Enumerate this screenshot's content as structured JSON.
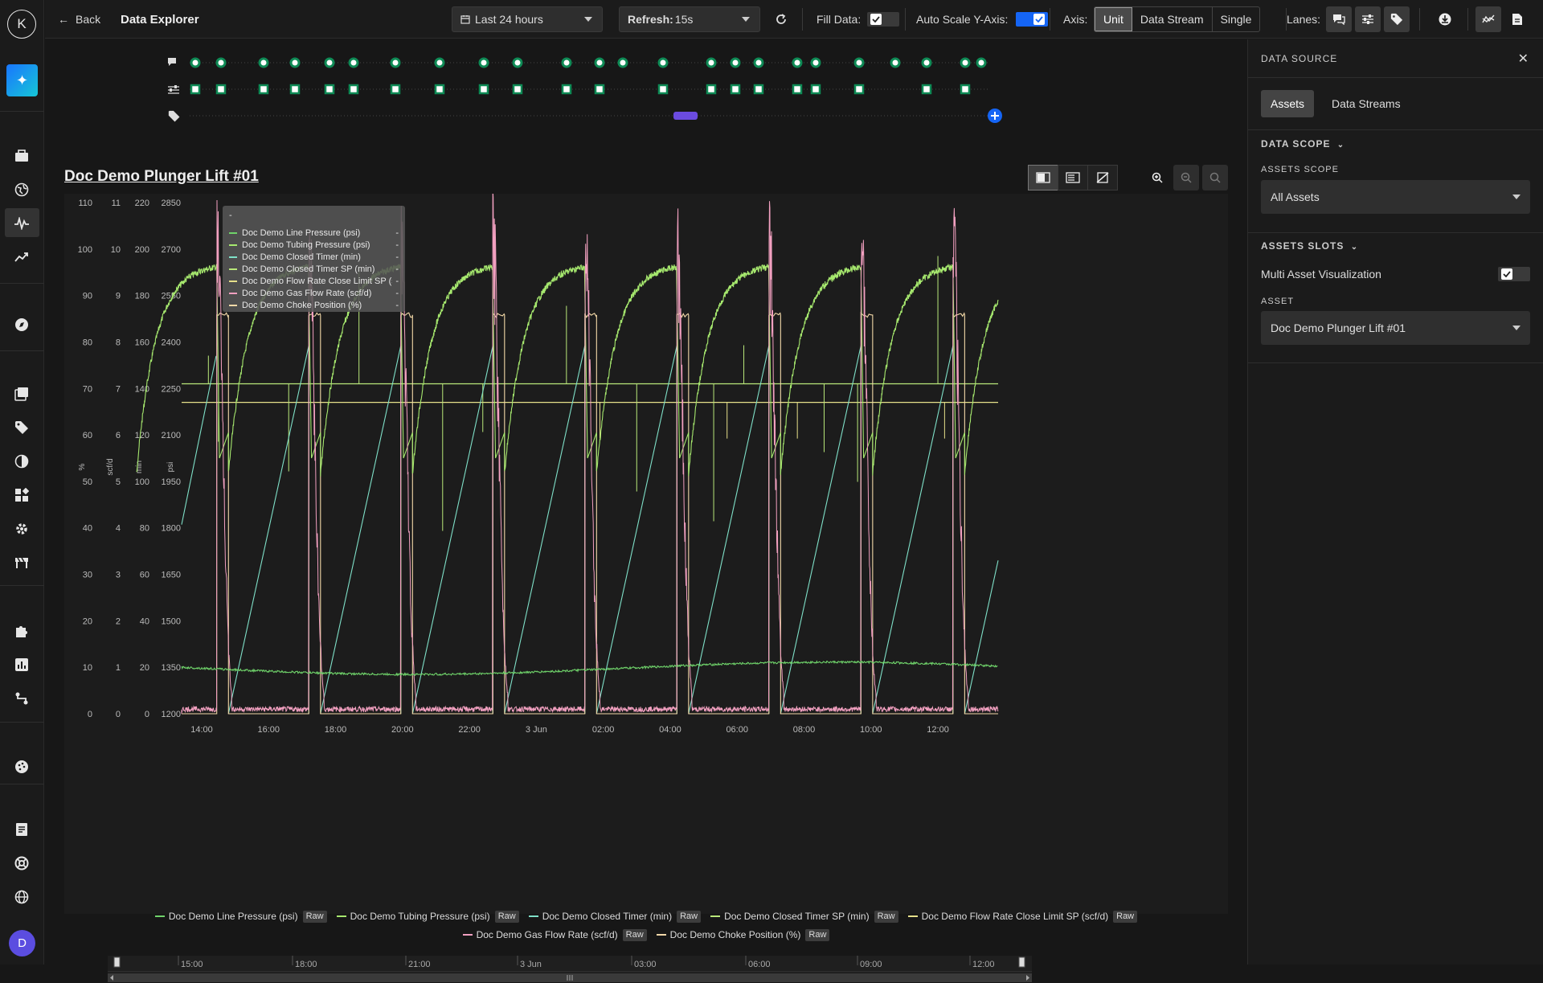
{
  "header": {
    "back_label": "Back",
    "title": "Data Explorer",
    "time_range": "Last 24 hours",
    "refresh_label": "Refresh:",
    "refresh_value": "15s",
    "fill_data_label": "Fill Data:",
    "fill_data_checked": true,
    "auto_scale_label": "Auto Scale Y-Axis:",
    "auto_scale_on": true,
    "axis_label": "Axis:",
    "axis_options": [
      "Unit",
      "Data Stream",
      "Single"
    ],
    "axis_selected": "Unit",
    "lanes_label": "Lanes:"
  },
  "sidebar": {
    "logo_letter": "K",
    "avatar_letter": "D"
  },
  "chart": {
    "title": "Doc Demo Plunger Lift #01",
    "tooltip_header": "-",
    "tooltip_rows": [
      {
        "label": "Doc Demo Line Pressure (psi)",
        "value": "-",
        "color": "#6fd36a"
      },
      {
        "label": "Doc Demo Tubing Pressure (psi)",
        "value": "-",
        "color": "#a6e86e"
      },
      {
        "label": "Doc Demo Closed Timer (min)",
        "value": "-",
        "color": "#7fe0c8"
      },
      {
        "label": "Doc Demo Closed Timer SP (min)",
        "value": "-",
        "color": "#b9e87a"
      },
      {
        "label": "Doc Demo Flow Rate Close Limit SP (scf/d)",
        "value": "-",
        "color": "#e6e08a"
      },
      {
        "label": "Doc Demo Gas Flow Rate (scf/d)",
        "value": "-",
        "color": "#f2a0c0"
      },
      {
        "label": "Doc Demo Choke Position (%)",
        "value": "-",
        "color": "#f3d9a8"
      }
    ],
    "legend": [
      {
        "label": "Doc Demo Line Pressure (psi)",
        "badge": "Raw",
        "color": "#6fd36a"
      },
      {
        "label": "Doc Demo Tubing Pressure (psi)",
        "badge": "Raw",
        "color": "#a6e86e"
      },
      {
        "label": "Doc Demo Closed Timer (min)",
        "badge": "Raw",
        "color": "#7fe0c8"
      },
      {
        "label": "Doc Demo Closed Timer SP (min)",
        "badge": "Raw",
        "color": "#b9e87a"
      },
      {
        "label": "Doc Demo Flow Rate Close Limit SP (scf/d)",
        "badge": "Raw",
        "color": "#e6e08a"
      },
      {
        "label": "Doc Demo Gas Flow Rate (scf/d)",
        "badge": "Raw",
        "color": "#f2a0c0"
      },
      {
        "label": "Doc Demo Choke Position (%)",
        "badge": "Raw",
        "color": "#f3d9a8"
      }
    ],
    "navigator_ticks": [
      "15:00",
      "18:00",
      "21:00",
      "3 Jun",
      "03:00",
      "06:00",
      "09:00",
      "12:00"
    ]
  },
  "chart_data": {
    "type": "line",
    "x_ticks": [
      "14:00",
      "16:00",
      "18:00",
      "20:00",
      "22:00",
      "3 Jun",
      "02:00",
      "04:00",
      "06:00",
      "08:00",
      "10:00",
      "12:00"
    ],
    "axes": [
      {
        "unit": "%",
        "ticks": [
          "0",
          "10",
          "20",
          "30",
          "40",
          "50",
          "60",
          "70",
          "80",
          "90",
          "100",
          "110"
        ]
      },
      {
        "unit": "scf/d",
        "ticks": [
          "0",
          "1",
          "2",
          "3",
          "4",
          "5",
          "6",
          "7",
          "8",
          "9",
          "10",
          "11"
        ]
      },
      {
        "unit": "min",
        "ticks": [
          "0",
          "20",
          "40",
          "60",
          "80",
          "100",
          "120",
          "140",
          "160",
          "180",
          "200",
          "220"
        ]
      },
      {
        "unit": "psi",
        "ticks": [
          "1200",
          "1350",
          "1500",
          "1650",
          "1800",
          "1950",
          "2100",
          "2250",
          "2400",
          "2550",
          "2700",
          "2850"
        ]
      }
    ],
    "cycle_hours": 2.75,
    "open_hours": [
      14.45,
      17.2,
      19.95,
      22.7,
      25.45,
      28.2,
      30.95,
      33.7,
      36.45
    ]
  },
  "right_panel": {
    "title": "DATA SOURCE",
    "tabs": [
      "Assets",
      "Data Streams"
    ],
    "active_tab": "Assets",
    "data_scope_label": "DATA SCOPE",
    "assets_scope_label": "ASSETS SCOPE",
    "assets_scope_value": "All Assets",
    "assets_slots_label": "ASSETS SLOTS",
    "multi_asset_label": "Multi Asset Visualization",
    "multi_asset_checked": true,
    "asset_label": "ASSET",
    "asset_value": "Doc Demo Plunger Lift #01"
  },
  "colors": {
    "line_pressure": "#6fd36a",
    "tubing_pressure": "#a6e86e",
    "closed_timer": "#7fe0c8",
    "closed_timer_sp": "#b9e87a",
    "flow_close_sp": "#e6e08a",
    "gas_flow": "#f2a0c0",
    "choke": "#f3d9a8",
    "accent": "#1565f5"
  }
}
